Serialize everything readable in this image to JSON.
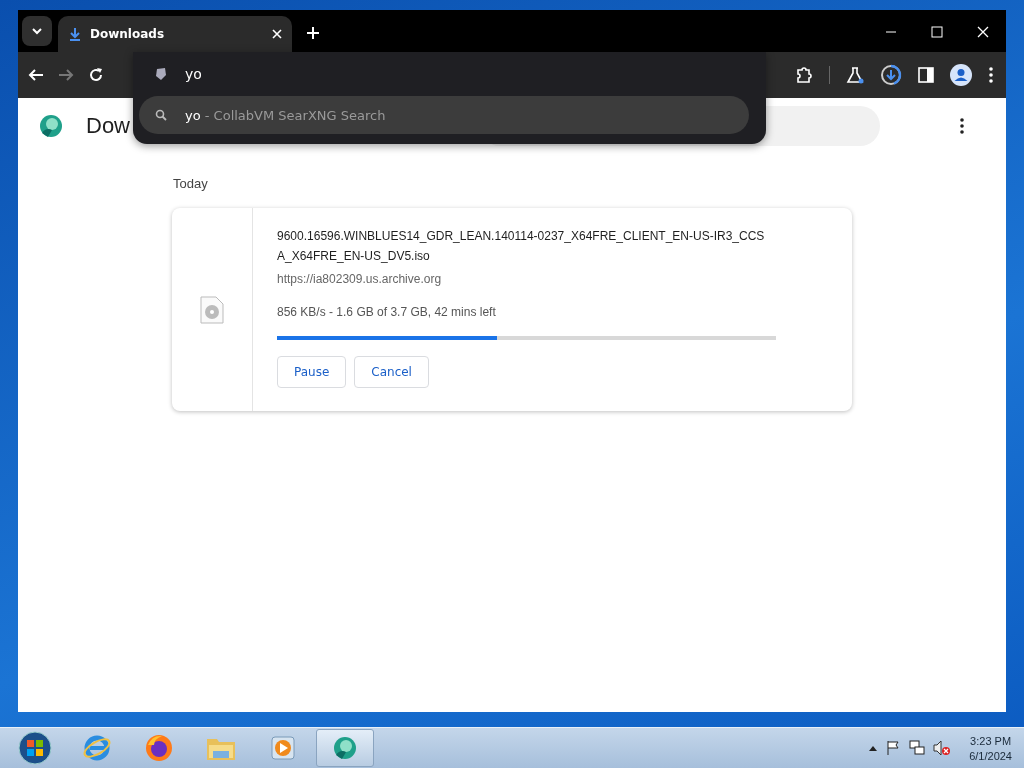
{
  "browser": {
    "tabs": [
      {
        "title": "Downloads",
        "selected": true
      }
    ],
    "omnibox": {
      "value": "yo",
      "suggestions": [
        {
          "query": "yo",
          "description": " - CollabVM SearXNG Search",
          "selected": true
        }
      ]
    },
    "page": {
      "title": "Dow"
    },
    "downloads": {
      "group": "Today",
      "items": [
        {
          "filename": "9600.16596.WINBLUES14_GDR_LEAN.140114-0237_X64FRE_CLIENT_EN-US-IR3_CCSA_X64FRE_EN-US_DV5.iso",
          "url": "https://ia802309.us.archive.org",
          "status": "856 KB/s - 1.6 GB of 3.7 GB, 42 mins left",
          "level": 0.44,
          "buttons": [
            "Pause",
            "Cancel"
          ]
        }
      ]
    }
  },
  "taskbar": {
    "apps": [
      {
        "kind": "ie",
        "selected": false
      },
      {
        "kind": "firefox",
        "selected": false
      },
      {
        "kind": "explorer",
        "selected": false
      },
      {
        "kind": "media",
        "selected": false
      },
      {
        "kind": "browser",
        "selected": true
      }
    ],
    "clock": {
      "time": "3:23 PM",
      "date": "6/1/2024"
    }
  }
}
